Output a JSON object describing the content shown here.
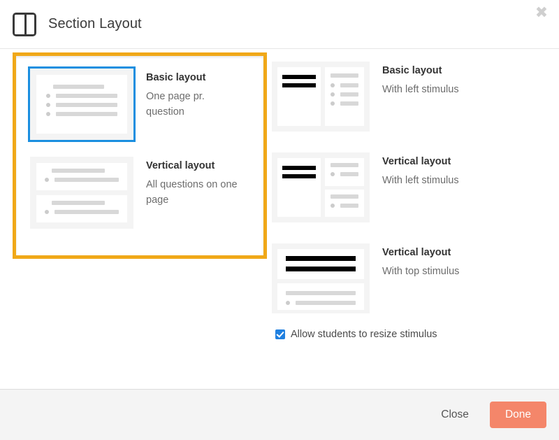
{
  "header": {
    "title": "Section Layout",
    "icon": "two-pane-layout-icon",
    "close_icon": "close-icon"
  },
  "highlight_color": "#f0a818",
  "selected_border_color": "#1b8fe0",
  "left_options": [
    {
      "title": "Basic layout",
      "description": "One page pr. question",
      "selected": true
    },
    {
      "title": "Vertical layout",
      "description": "All questions on one page",
      "selected": false
    }
  ],
  "right_options": [
    {
      "title": "Basic layout",
      "description": "With left stimulus",
      "selected": false
    },
    {
      "title": "Vertical layout",
      "description": "With left stimulus",
      "selected": false
    },
    {
      "title": "Vertical layout",
      "description": "With top stimulus",
      "selected": false
    }
  ],
  "checkbox": {
    "label": "Allow students to resize stimulus",
    "checked": true,
    "color": "#2080e0"
  },
  "footer": {
    "close_label": "Close",
    "done_label": "Done",
    "done_color": "#f4866a"
  }
}
